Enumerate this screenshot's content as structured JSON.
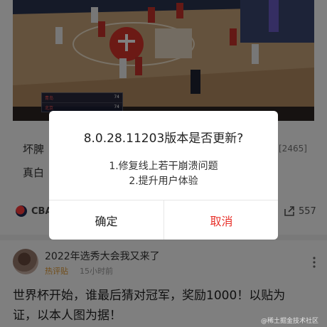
{
  "feed": {
    "post1": {
      "title_line1": "坏脾",
      "tag_suffix": "[2465]",
      "title_line2": "真白",
      "source_name": "CBA",
      "share_count": "557",
      "scoreboard": [
        {
          "team": "青岛",
          "score": "74"
        },
        {
          "team": "北京",
          "score": "74"
        }
      ]
    },
    "post2": {
      "title": "2022年选秀大会我又来了",
      "tag": "热评贴",
      "time": "15小时前",
      "body": "世界杯开始，谁最后猜对冠军，奖励1000！以贴为证，以本人图为据！"
    },
    "watermark": "@稀土掘金技术社区"
  },
  "dialog": {
    "title": "8.0.28.11203版本是否更新?",
    "lines": [
      "1.修复线上若干崩溃问题",
      "2.提升用户体验"
    ],
    "confirm_label": "确定",
    "cancel_label": "取消"
  },
  "colors": {
    "overlay": "#00000080",
    "cancel": "#e8312a",
    "tag": "#e39a32"
  },
  "icons": {
    "share": "share-icon",
    "more": "more-vertical-icon",
    "source": "cba-logo-icon"
  }
}
